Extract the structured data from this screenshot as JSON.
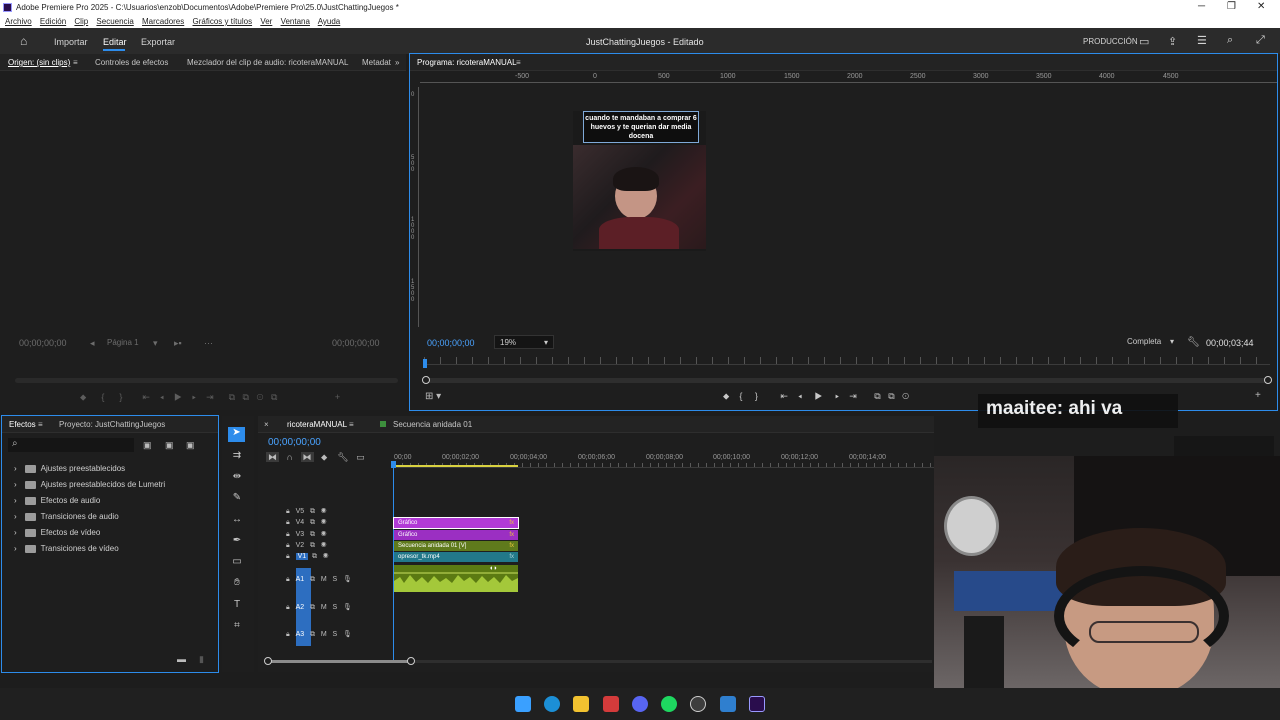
{
  "window": {
    "title": "Adobe Premiere Pro 2025 - C:\\Usuarios\\enzob\\Documentos\\Adobe\\Premiere Pro\\25.0\\JustChattingJuegos *"
  },
  "menu": [
    "Archivo",
    "Edición",
    "Clip",
    "Secuencia",
    "Marcadores",
    "Gráficos y títulos",
    "Ver",
    "Ventana",
    "Ayuda"
  ],
  "workspace": {
    "tabs": [
      "Importar",
      "Editar",
      "Exportar"
    ],
    "active": "Editar",
    "project_title": "JustChattingJuegos - Editado",
    "mode": "PRODUCCIÓN"
  },
  "source": {
    "tabs": [
      "Origen: (sin clips)",
      "Controles de efectos",
      "Mezclador del clip de audio: ricoteraMANUAL",
      "Metadat"
    ],
    "tc_left": "00;00;00;00",
    "tc_right": "00;00;00;00",
    "page": "Página 1"
  },
  "program": {
    "tab": "Programa: ricoteraMANUAL",
    "ruler": [
      "-500",
      "0",
      "500",
      "1000",
      "1500",
      "2000",
      "2500",
      "3000",
      "3500",
      "4000",
      "4500"
    ],
    "vertical_ruler": [
      "0",
      "5 0 0",
      "1 0 0 0",
      "1 5 0 0"
    ],
    "caption": "cuando te mandaban a comprar 6 huevos y te querian dar media docena",
    "timecode": "00;00;00;00",
    "zoom": "19%",
    "quality": "Completa",
    "duration": "00;00;03;44"
  },
  "effects": {
    "tabs": [
      "Efectos",
      "Proyecto: JustChattingJuegos"
    ],
    "items": [
      "Ajustes preestablecidos",
      "Ajustes preestablecidos de Lumetri",
      "Efectos de audio",
      "Transiciones de audio",
      "Efectos de vídeo",
      "Transiciones de vídeo"
    ]
  },
  "timeline": {
    "tabs": [
      "ricoteraMANUAL",
      "Secuencia anidada 01"
    ],
    "timecode": "00;00;00;00",
    "ruler": [
      "00;00",
      "00;00;02;00",
      "00;00;04;00",
      "00;00;06;00",
      "00;00;08;00",
      "00;00;10;00",
      "00;00;12;00",
      "00;00;14;00"
    ],
    "video_tracks": [
      "V5",
      "V4",
      "V3",
      "V2",
      "V1"
    ],
    "audio_tracks": [
      "A1",
      "A2",
      "A3"
    ],
    "clips": [
      {
        "label": "Gráfico",
        "color": "#b23ad6"
      },
      {
        "label": "Gráfico",
        "color": "#9b2fc2"
      },
      {
        "label": "Secuencia anidada 01 [V]",
        "color": "#5f7a1c"
      },
      {
        "label": "opresor_tk.mp4",
        "color": "#22788a"
      }
    ],
    "fx": "fx",
    "m": "M",
    "s": "S"
  },
  "overlay": {
    "chat": "maaitee: ahi va"
  },
  "colors": {
    "accent": "#2d8ceb",
    "purple": "#b23ad6",
    "audio": "#7ba01c"
  }
}
